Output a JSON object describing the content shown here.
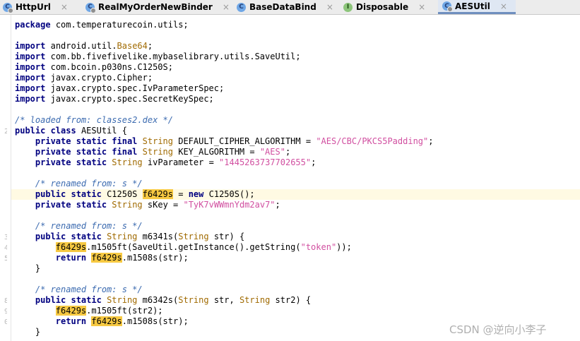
{
  "tabs": [
    {
      "label": "HttpUrl",
      "icon_letter": "C",
      "icon_kind": "class-icon",
      "active": false
    },
    {
      "label": "RealMyOrderNewBinder",
      "icon_letter": "C",
      "icon_kind": "class-icon",
      "active": false
    },
    {
      "label": "BaseDataBind",
      "icon_letter": "C",
      "icon_kind": "class-icon",
      "active": false
    },
    {
      "label": "Disposable",
      "icon_letter": "I",
      "icon_kind": "interface-icon",
      "active": false
    },
    {
      "label": "AESUtil",
      "icon_letter": "C",
      "icon_kind": "class-icon",
      "active": true
    }
  ],
  "close_glyph": "×",
  "gutter_numbers": [
    "2",
    "3",
    "4",
    "5",
    "8",
    "9",
    "0"
  ],
  "code": {
    "package_kw": "package",
    "package_name": "com.temperaturecoin.utils;",
    "import_kw": "import",
    "imports": [
      "android.util.Base64;",
      "com.bb.fivefivelike.mybaselibrary.utils.SaveUtil;",
      "com.bcoin.p030ns.C1250S;",
      "javax.crypto.Cipher;",
      "javax.crypto.spec.IvParameterSpec;",
      "javax.crypto.spec.SecretKeySpec;"
    ],
    "import_base64_pkg": "android.util.",
    "import_base64_cls": "Base64",
    "comment_loaded": "/* loaded from: classes2.dex */",
    "class_decl_kw": "public class",
    "class_name": "AESUtil {",
    "private_static_final": "private static final",
    "private_static": "private static",
    "public_static": "public static",
    "string_type": "String",
    "cipher_name": "DEFAULT_CIPHER_ALGORITHM = ",
    "cipher_value": "\"AES/CBC/PKCS5Padding\"",
    "key_alg_name": "KEY_ALGORITHM = ",
    "key_alg_value": "\"AES\"",
    "iv_name": "ivParameter = ",
    "iv_value": "\"1445263737702655\"",
    "comment_renamed": "/* renamed from: s */",
    "field_type": "C1250S",
    "field_name": "f6429s",
    "new_expr_kw": "new",
    "new_expr_rest": "C1250S();",
    "skey_name": "sKey = ",
    "skey_value": "\"TyK7vWWmnYdm2av7\"",
    "m1_name": "m6341s(",
    "m1_params_type": "String",
    "m1_params_rest": "str) {",
    "call1": ".m1505ft(SaveUtil.getInstance().getString(",
    "token_value": "\"token\"",
    "call1_end": "));",
    "return_kw": "return",
    "call2": ".m1508s(str);",
    "close_brace": "}",
    "m2_name": "m6342s(",
    "m2_params_mid": "str, ",
    "m2_params_rest": "str2) {",
    "call3": ".m1505ft(str2);",
    "semicolon": ";"
  },
  "watermark": "CSDN @逆向小李子"
}
